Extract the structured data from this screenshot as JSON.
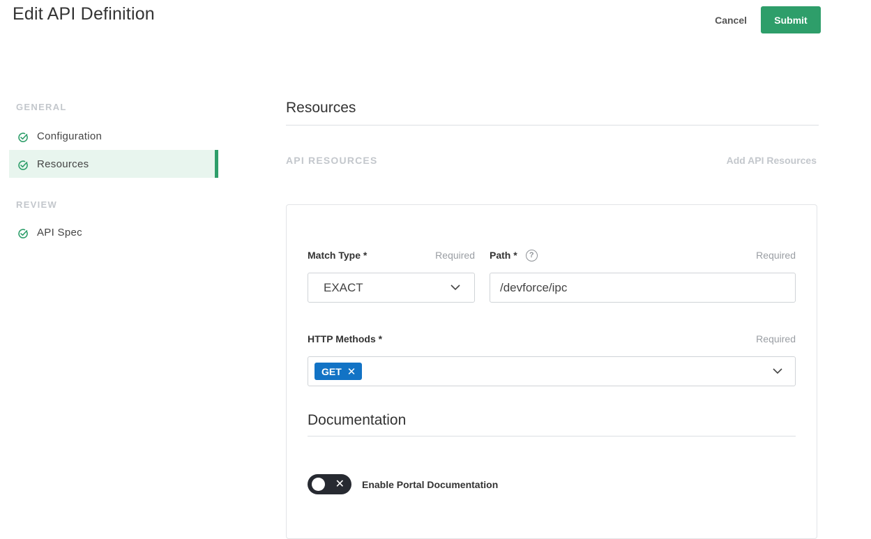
{
  "header": {
    "title": "Edit API Definition",
    "cancel_label": "Cancel",
    "submit_label": "Submit",
    "submit_color": "#2e9e6a"
  },
  "sidebar": {
    "sections": [
      {
        "label": "GENERAL",
        "items": [
          {
            "label": "Configuration",
            "icon": "check-circle-icon",
            "active": false
          },
          {
            "label": "Resources",
            "icon": "check-circle-icon",
            "active": true
          }
        ]
      },
      {
        "label": "REVIEW",
        "items": [
          {
            "label": "API Spec",
            "icon": "check-circle-icon",
            "active": false
          }
        ]
      }
    ]
  },
  "main": {
    "section_title": "Resources",
    "subheader": "API RESOURCES",
    "add_link": "Add API Resources",
    "match_type": {
      "label": "Match Type *",
      "required": "Required",
      "value": "EXACT"
    },
    "path": {
      "label": "Path *",
      "required": "Required",
      "value": "/devforce/ipc",
      "help_icon": "?"
    },
    "http_methods": {
      "label": "HTTP Methods *",
      "required": "Required",
      "chips": [
        "GET"
      ],
      "chip_color": "#1273c5"
    },
    "documentation": {
      "title": "Documentation",
      "toggle_label": "Enable Portal Documentation",
      "toggle_on": false
    }
  }
}
